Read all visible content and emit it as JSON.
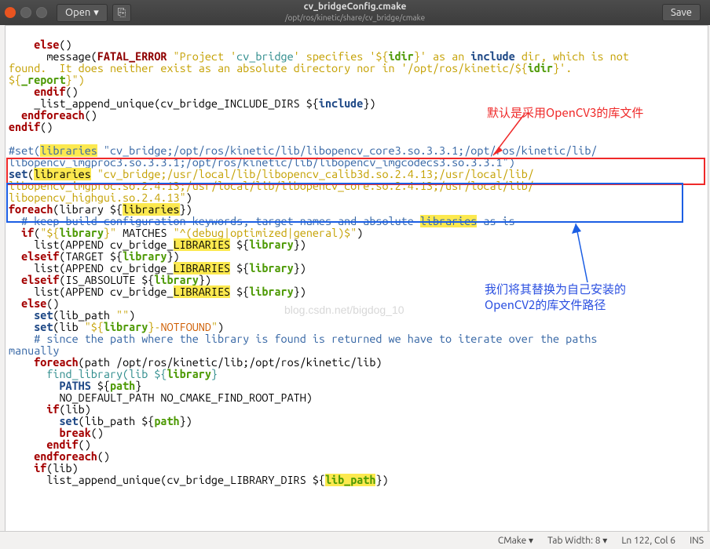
{
  "titlebar": {
    "open_label": "Open",
    "title": "cv_bridgeConfig.cmake",
    "subtitle": "/opt/ros/kinetic/share/cv_bridge/cmake",
    "save_label": "Save"
  },
  "code": {
    "l1a": "    else",
    "l1b": "()",
    "l2a": "      message(",
    "l2b": "FATAL_ERROR ",
    "l2c": "\"Project '",
    "l2d": "cv_bridge",
    "l2e": "' specifies '${",
    "l2f": "idir",
    "l2g": "}' as an ",
    "l2h": "include",
    "l2i": " dir, which is not",
    "l3a": "found.  It does neither exist as an absolute directory nor in '/opt/ros/kinetic/${",
    "l3b": "idir",
    "l3c": "}'.",
    "l4a": "${",
    "l4b": "_report",
    "l4c": "}\")",
    "l5a": "    endif",
    "l5b": "()",
    "l6a": "    _list_append_unique(cv_bridge_INCLUDE_DIRS ${",
    "l6b": "include",
    "l6c": "})",
    "l7a": "  endforeach",
    "l7b": "()",
    "l8a": "endif",
    "l8b": "()",
    "l9": "",
    "l10a": "#set(",
    "l10b": "libraries",
    "l10c": " \"cv_bridge;/opt/ros/kinetic/lib/libopencv_core3.so.3.3.1;/opt/ros/kinetic/lib/",
    "l11": "libopencv_imgproc3.so.3.3.1;/opt/ros/kinetic/lib/libopencv_imgcodecs3.so.3.3.1\")",
    "l12a": "set",
    "l12b": "(",
    "l12c": "libraries",
    "l12d": " ",
    "l12e": "\"cv_bridge;/usr/local/lib/libopencv_calib3d.so.2.4.13;/usr/local/lib/",
    "l13": "libopencv_imgproc.so.2.4.13;/usr/local/lib/libopencv_core.so.2.4.13;/usr/local/lib/",
    "l14": "libopencv_highgui.so.2.4.13\"",
    "l14b": ")",
    "l15a": "foreach",
    "l15b": "(library ${",
    "l15c": "libraries",
    "l15d": "})",
    "l16a": "  # keep build configuration keywords, target names and absolute ",
    "l16b": "libraries",
    "l16c": " as-is",
    "l17a": "  if",
    "l17b": "(",
    "l17c": "\"${",
    "l17d": "library",
    "l17e": "}\"",
    "l17f": " MATCHES ",
    "l17g": "\"^(debug|optimized|general)$\"",
    "l17h": ")",
    "l18a": "    list(APPEND cv_bridge_",
    "l18b": "LIBRARIES",
    "l18c": " ${",
    "l18d": "library",
    "l18e": "})",
    "l19a": "  elseif",
    "l19b": "(TARGET ${",
    "l19c": "library",
    "l19d": "})",
    "l20a": "    list(APPEND cv_bridge_",
    "l20b": "LIBRARIES",
    "l20c": " ${",
    "l20d": "library",
    "l20e": "})",
    "l21a": "  elseif",
    "l21b": "(IS_ABSOLUTE ${",
    "l21c": "library",
    "l21d": "})",
    "l22a": "    list(APPEND cv_bridge_",
    "l22b": "LIBRARIES",
    "l22c": " ${",
    "l22d": "library",
    "l22e": "})",
    "l23a": "  else",
    "l23b": "()",
    "l24a": "    set",
    "l24b": "(lib_path ",
    "l24c": "\"\"",
    "l24d": ")",
    "l25a": "    set",
    "l25b": "(lib ",
    "l25c": "\"${",
    "l25d": "library",
    "l25e": "}-",
    "l25f": "NOTFOUND",
    "l25g": "\"",
    "l25h": ")",
    "l26a": "    # since the path where the library is found is returned we have to iterate over the paths",
    "l27": "manually",
    "l28a": "    foreach",
    "l28b": "(path /opt/ros/kinetic/lib;/opt/ros/kinetic/lib)",
    "l29a": "      find_library(lib ${",
    "l29b": "library",
    "l29c": "}",
    "l30a": "        ",
    "l30b": "PATHS",
    "l30c": " ${",
    "l30d": "path",
    "l30e": "}",
    "l31": "        NO_DEFAULT_PATH NO_CMAKE_FIND_ROOT_PATH)",
    "l32a": "      if",
    "l32b": "(lib)",
    "l33a": "        set",
    "l33b": "(lib_path ${",
    "l33c": "path",
    "l33d": "})",
    "l34a": "        break",
    "l34b": "()",
    "l35a": "      endif",
    "l35b": "()",
    "l36a": "    endforeach",
    "l36b": "()",
    "l37a": "    if",
    "l37b": "(lib)",
    "l38a": "      list_append_unique(cv_bridge_LIBRARY_DIRS ${",
    "l38b": "lib_path",
    "l38c": "})"
  },
  "annotations": {
    "red_text": "默认是采用OpenCV3的库文件",
    "blue_text1": "我们将其替换为自己安装的",
    "blue_text2": "OpenCV2的库文件路径"
  },
  "watermark": "blog.csdn.net/bigdog_10",
  "statusbar": {
    "language": "CMake",
    "tab_width": "Tab Width: 8",
    "position": "Ln 122, Col 6",
    "insert_mode": "INS"
  }
}
